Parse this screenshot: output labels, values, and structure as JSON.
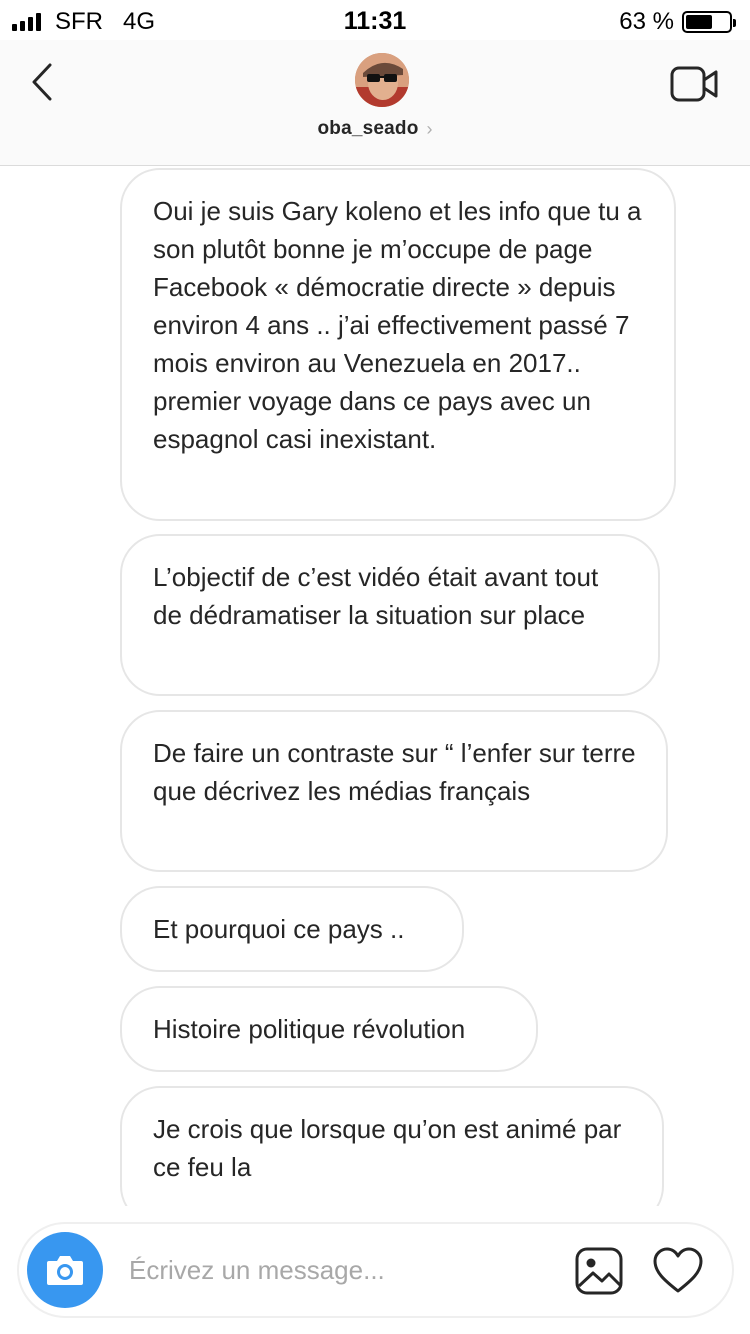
{
  "status_bar": {
    "carrier": "SFR",
    "network": "4G",
    "time": "11:31",
    "battery_percent": "63 %",
    "battery_level": 0.63
  },
  "header": {
    "username": "oba_seado",
    "chevron": "›",
    "back_icon": "chevron-left-icon",
    "video_icon": "video-camera-icon"
  },
  "messages": [
    {
      "text": "Oui je suis Gary koleno  et les info que tu a son plutôt bonne je m’occupe de page Facebook « démocratie directe » depuis environ 4 ans .. j’ai effectivement passé 7 mois environ au Venezuela en 2017.. premier voyage dans ce pays avec un espagnol casi inexistant."
    },
    {
      "text": "L’objectif de c’est vidéo était avant tout de dédramatiser la situation sur place"
    },
    {
      "text": "De faire un contraste sur “ l’enfer sur terre que décrivez les médias français"
    },
    {
      "text": "Et pourquoi ce pays .."
    },
    {
      "text": "Histoire politique révolution"
    },
    {
      "text": "Je crois que lorsque qu’on est animé par ce feu la"
    }
  ],
  "composer": {
    "placeholder": "Écrivez un message...",
    "camera_icon": "camera-icon",
    "gallery_icon": "gallery-icon",
    "like_icon": "heart-icon"
  },
  "colors": {
    "accent": "#3897f0",
    "bubble_border": "#e6e6e6",
    "text": "#262626",
    "placeholder": "#a8a8a8"
  }
}
